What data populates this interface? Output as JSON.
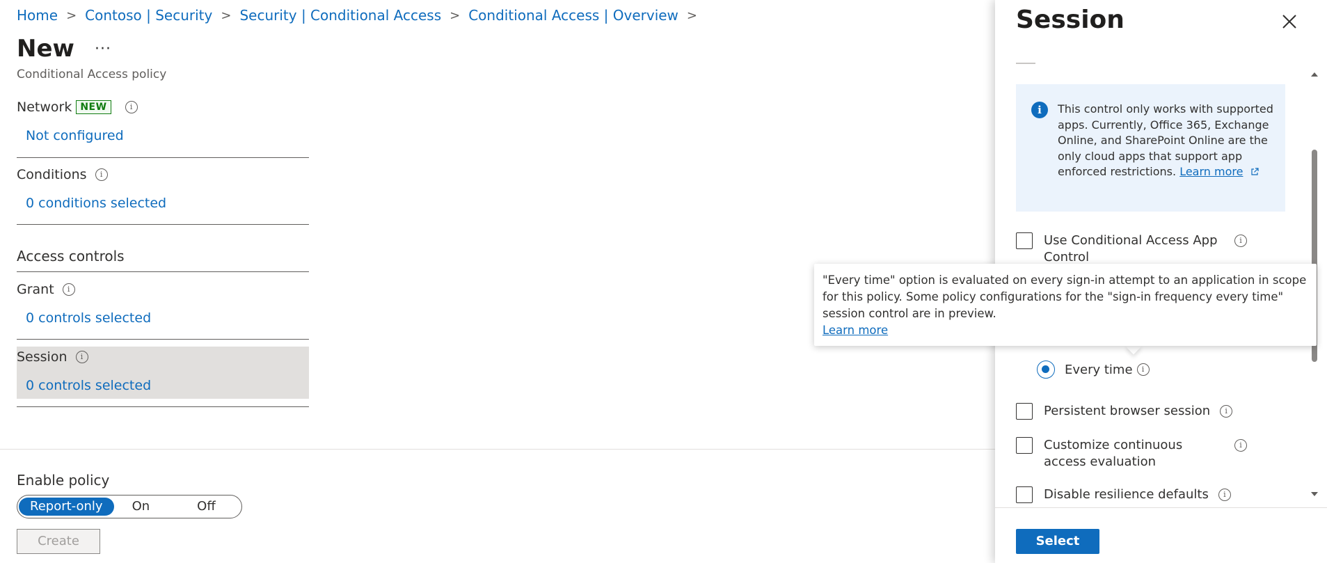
{
  "breadcrumb": {
    "items": [
      "Home",
      "Contoso | Security",
      "Security | Conditional Access",
      "Conditional Access | Overview"
    ]
  },
  "page": {
    "title": "New",
    "more": "···",
    "subtitle": "Conditional Access policy"
  },
  "sections": {
    "network": {
      "label": "Network",
      "badge": "NEW",
      "value": "Not configured"
    },
    "conditions": {
      "label": "Conditions",
      "value": "0 conditions selected"
    },
    "access_controls": {
      "label": "Access controls"
    },
    "grant": {
      "label": "Grant",
      "value": "0 controls selected"
    },
    "session": {
      "label": "Session",
      "value": "0 controls selected"
    }
  },
  "enable_policy": {
    "label": "Enable policy",
    "options": [
      "Report-only",
      "On",
      "Off"
    ],
    "selected": "Report-only",
    "create_label": "Create"
  },
  "panel": {
    "title": "Session",
    "info_text": "This control only works with supported apps. Currently, Office 365, Exchange Online, and SharePoint Online are the only cloud apps that support app enforced restrictions.",
    "info_learn_more": "Learn more",
    "options": {
      "app_control": "Use Conditional Access App Control",
      "every_time": "Every time",
      "persistent": "Persistent browser session",
      "cae": "Customize continuous access evaluation",
      "resilience": "Disable resilience defaults"
    },
    "select_label": "Select"
  },
  "tooltip": {
    "text": "\"Every time\" option is evaluated on every sign-in attempt to an application in scope for this policy. Some policy configurations for the \"sign-in frequency every time\" session control are in preview.",
    "learn_more": "Learn more"
  },
  "colors": {
    "accent": "#0f6cbd",
    "new_badge": "#107c10",
    "highlight": "#e1dfdd",
    "info_bg": "#ebf3fc"
  }
}
